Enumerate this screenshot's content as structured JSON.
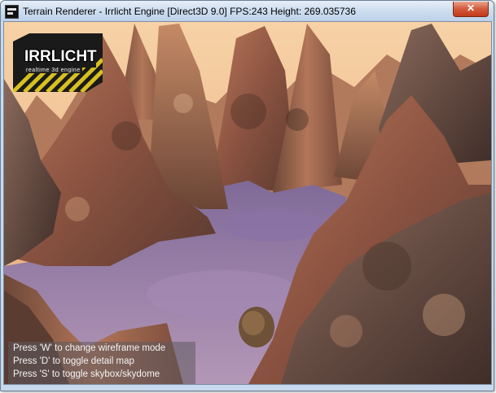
{
  "window": {
    "title": "Terrain Renderer - Irrlicht Engine [Direct3D 9.0] FPS:243 Height: 269.035736",
    "close_label": "✕"
  },
  "logo": {
    "text": "IRRLICHT",
    "subtitle": "realtime 3d engine"
  },
  "help": {
    "lines": [
      "Press 'W' to change wireframe mode",
      "Press 'D' to toggle detail map",
      "Press 'S' to toggle skybox/skydome"
    ]
  },
  "colors": {
    "sky": "#f4c898",
    "rock": "#a8664a",
    "water": "#9a7ab0"
  }
}
